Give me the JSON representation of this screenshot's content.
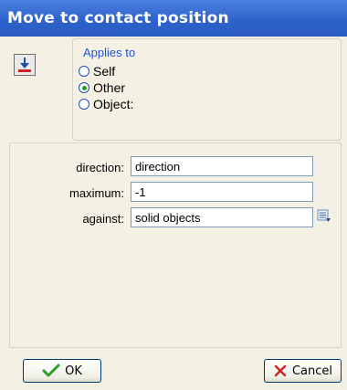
{
  "window": {
    "title": "Move to contact position"
  },
  "action_icon": "move-to-contact-icon",
  "applies_to": {
    "label": "Applies to",
    "options": [
      {
        "label": "Self",
        "checked": false
      },
      {
        "label": "Other",
        "checked": true
      },
      {
        "label": "Object:",
        "checked": false
      }
    ]
  },
  "params": [
    {
      "label": "direction:",
      "value": "direction"
    },
    {
      "label": "maximum:",
      "value": "-1"
    },
    {
      "label": "against:",
      "value": "solid objects",
      "menu_icon": "menu-icon"
    }
  ],
  "buttons": {
    "ok_label": "OK",
    "cancel_label": "Cancel"
  },
  "colors": {
    "titlebar": "#2e63cc",
    "applies_label": "#1f55d0",
    "ok_check": "#2b9e2b",
    "cancel_x": "#d32222"
  }
}
